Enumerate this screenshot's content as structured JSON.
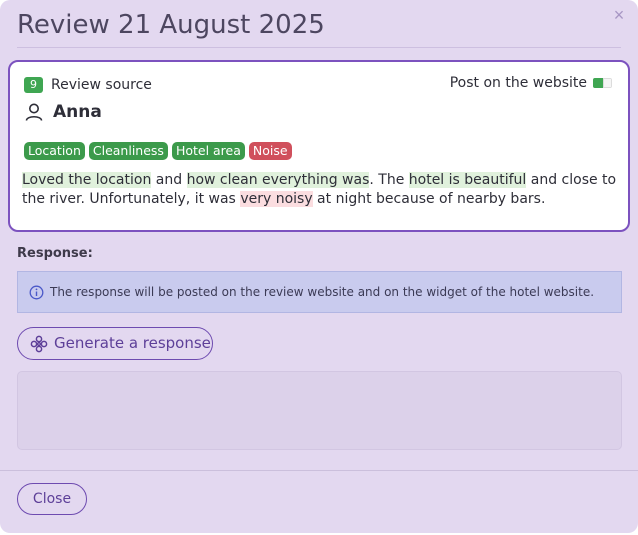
{
  "dialog": {
    "title": "Review 21 August 2025",
    "close_glyph": "×"
  },
  "review": {
    "source_count": "9",
    "source_label": "Review source",
    "post_label": "Post on the website",
    "post_enabled": true,
    "reviewer": "Anna",
    "tags": [
      {
        "label": "Location",
        "sentiment": "positive"
      },
      {
        "label": "Cleanliness",
        "sentiment": "positive"
      },
      {
        "label": "Hotel area",
        "sentiment": "positive"
      },
      {
        "label": "Noise",
        "sentiment": "negative"
      }
    ],
    "text": [
      {
        "t": "Loved the location",
        "hl": "positive"
      },
      {
        "t": " and ",
        "hl": ""
      },
      {
        "t": "how clean everything was",
        "hl": "positive"
      },
      {
        "t": ". The ",
        "hl": ""
      },
      {
        "t": "hotel is beautiful",
        "hl": "positive"
      },
      {
        "t": " and close to the river. Unfortunately, it was ",
        "hl": ""
      },
      {
        "t": "very noisy",
        "hl": "negative"
      },
      {
        "t": " at night because of nearby bars.",
        "hl": ""
      }
    ]
  },
  "response": {
    "label": "Response:",
    "info": "The response will be posted on the review website and on the widget of the hotel website.",
    "generate_label": "Generate a response",
    "value": ""
  },
  "footer": {
    "close_label": "Close"
  },
  "icons": {
    "user": "user-icon",
    "info": "info-icon",
    "generate": "sparkle-flower-icon"
  },
  "colors": {
    "accent": "#7c52bf",
    "positive": "#3c9a4b",
    "negative": "#d0505c",
    "positive_highlight": "#e0f1dc",
    "negative_highlight": "#fbdde0"
  }
}
